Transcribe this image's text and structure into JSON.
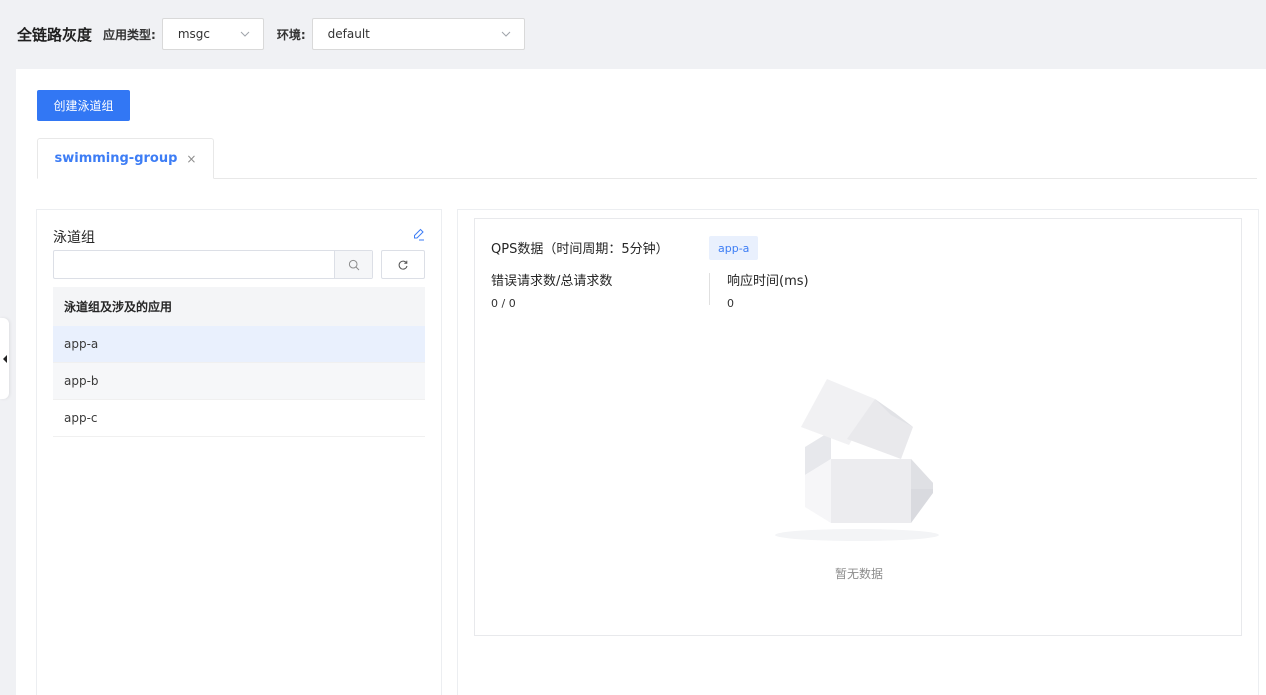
{
  "header": {
    "title": "全链路灰度",
    "app_type_label": "应用类型:",
    "app_type_value": "msgc",
    "env_label": "环境:",
    "env_value": "default"
  },
  "actions": {
    "create_label": "创建泳道组"
  },
  "tabs": [
    {
      "label": "swimming-group",
      "close": "×"
    }
  ],
  "left_panel": {
    "title": "泳道组",
    "search_value": "",
    "list_header": "泳道组及涉及的应用",
    "items": [
      "app-a",
      "app-b",
      "app-c"
    ]
  },
  "right_panel": {
    "qps_title": "QPS数据（时间周期：5分钟）",
    "app_tag": "app-a",
    "metrics": [
      {
        "label": "错误请求数/总请求数",
        "value": "0 / 0"
      },
      {
        "label": "响应时间(ms)",
        "value": "0"
      }
    ],
    "empty_text": "暂无数据"
  },
  "colors": {
    "primary": "#3277f4",
    "tab_active": "#3d7df5",
    "selected_row": "#e9f0fd",
    "page_bg": "#f0f1f4"
  },
  "icons": [
    "chevron-down-icon",
    "edit-pencil-icon",
    "search-icon",
    "refresh-icon",
    "caret-left-icon",
    "empty-box-icon"
  ]
}
